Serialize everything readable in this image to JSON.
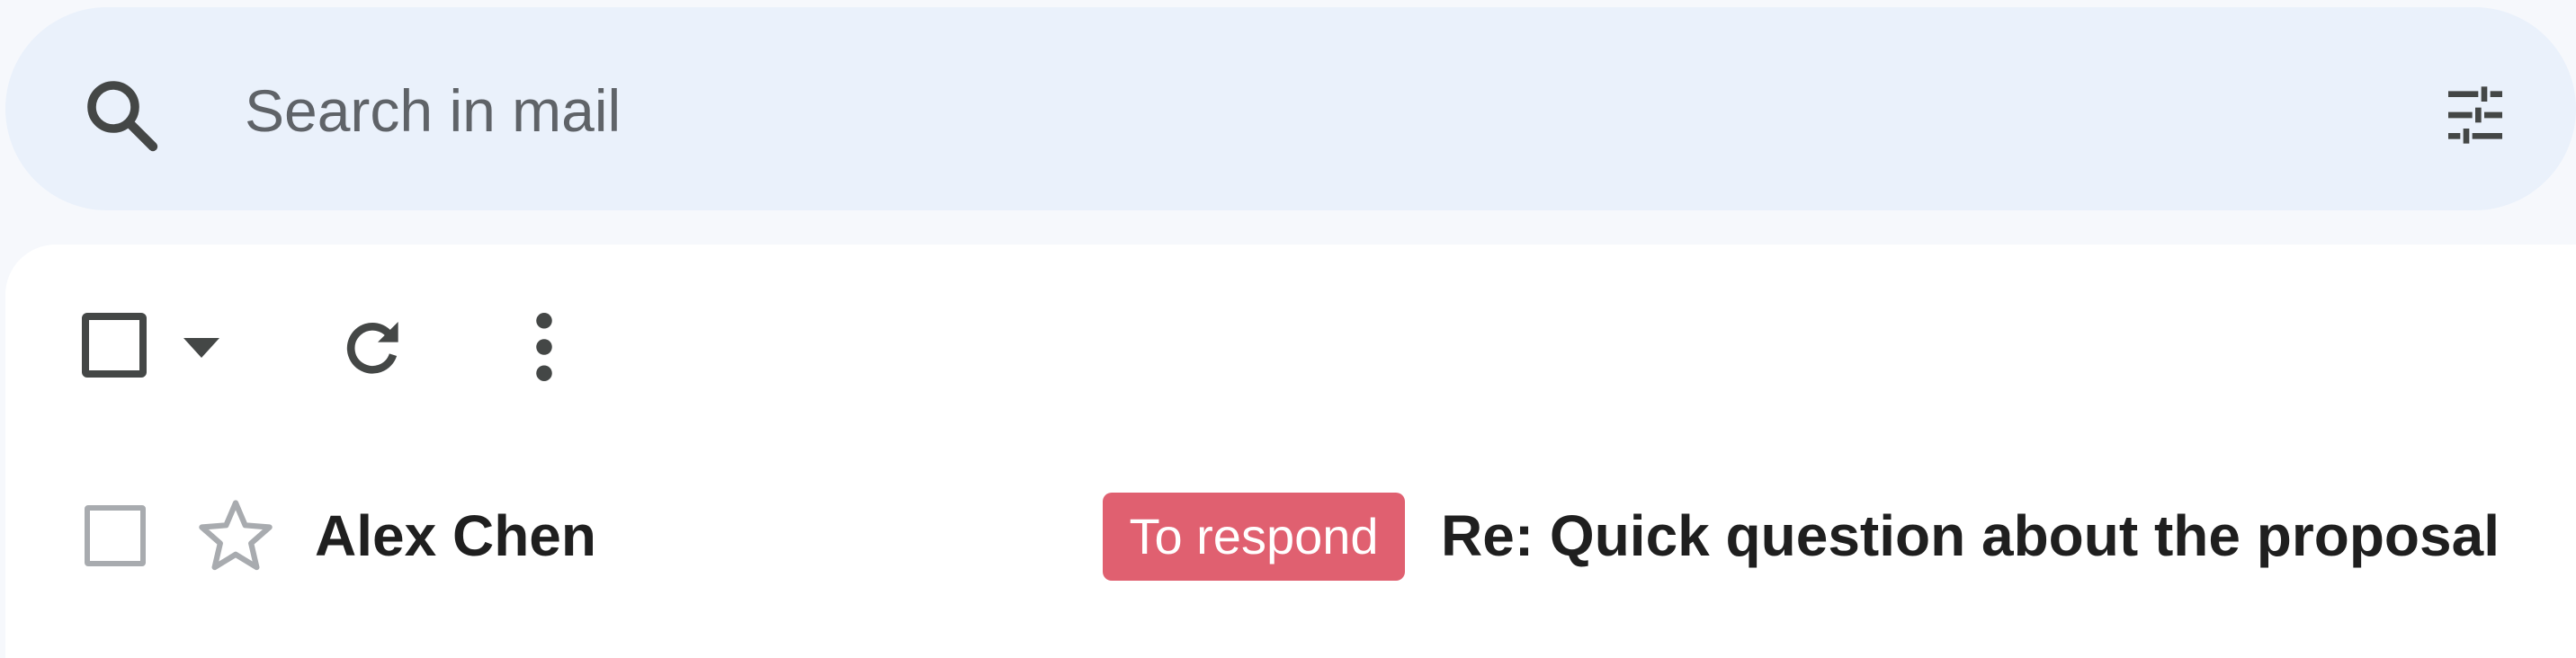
{
  "search": {
    "placeholder": "Search in mail",
    "icon": "search-icon",
    "options_icon": "search-options-icon"
  },
  "toolbar": {
    "select_icon": "checkbox-icon",
    "select_dropdown_icon": "caret-down-icon",
    "refresh_icon": "refresh-icon",
    "more_icon": "more-vertical-icon"
  },
  "emails": [
    {
      "sender": "Alex Chen",
      "label": "To respond",
      "label_color": "#e06070",
      "subject": "Re: Quick question about the proposal",
      "starred": false,
      "checked": false,
      "unread": true
    }
  ],
  "colors": {
    "search_bg": "#eaf1fb",
    "page_bg": "#f6f8fc",
    "icon": "#444746",
    "text": "#1f1f1f"
  }
}
